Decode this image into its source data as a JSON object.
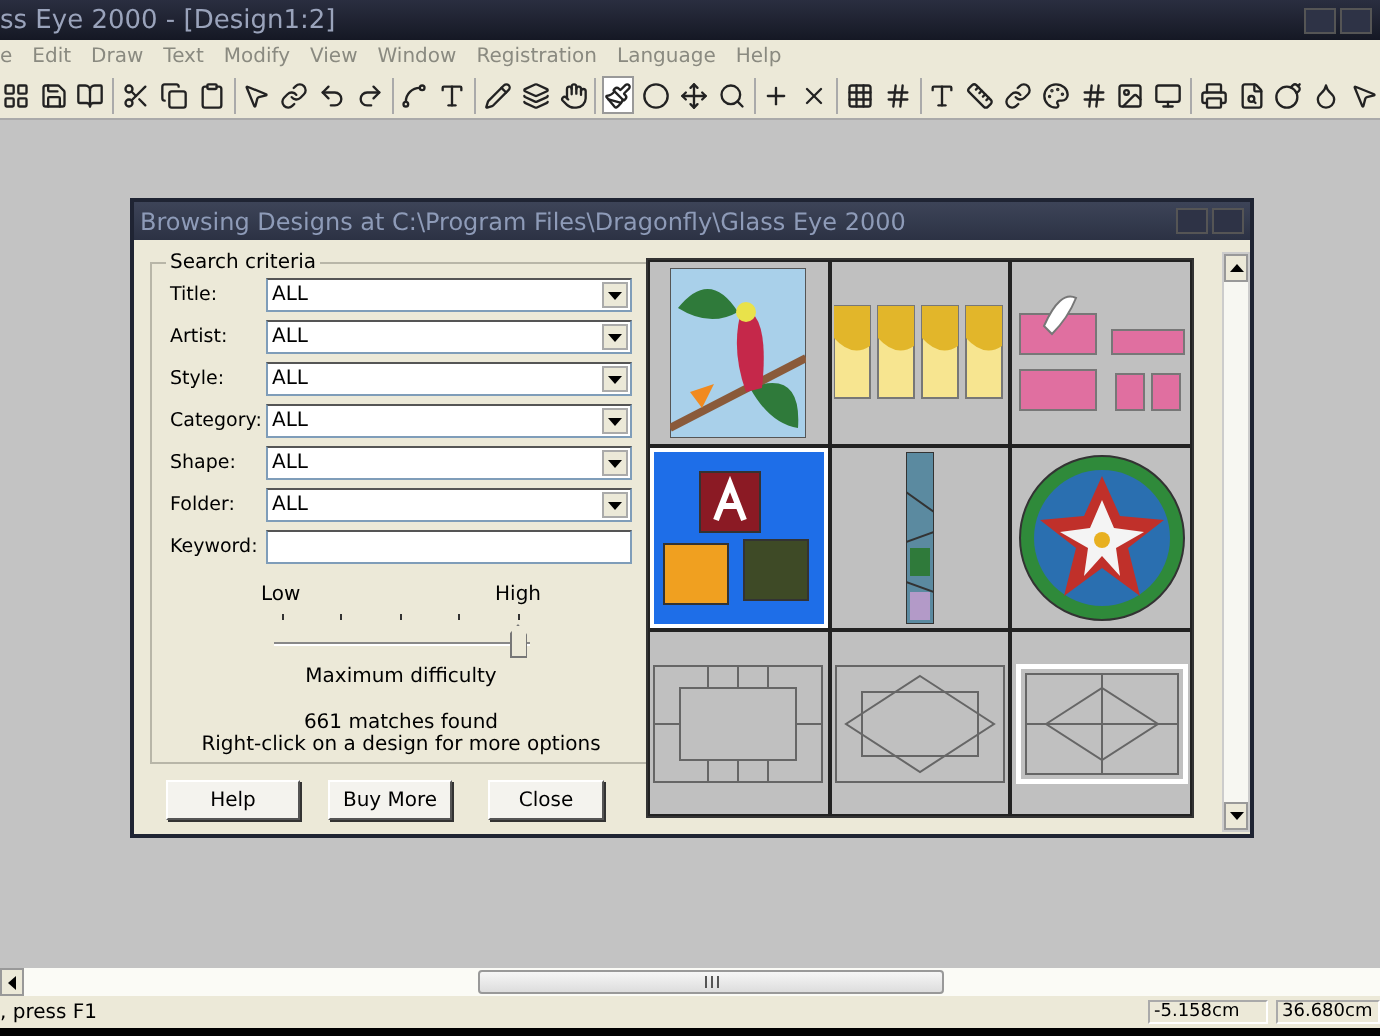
{
  "window": {
    "title": "ss Eye 2000 - [Design1:2]"
  },
  "menu": [
    "e",
    "Edit",
    "Draw",
    "Text",
    "Modify",
    "View",
    "Window",
    "Registration",
    "Language",
    "Help"
  ],
  "dialog": {
    "title": "Browsing Designs at C:\\Program Files\\Dragonfly\\Glass Eye 2000",
    "group_title": "Search criteria",
    "fields": [
      {
        "label": "Title:",
        "value": "ALL",
        "kind": "combo"
      },
      {
        "label": "Artist:",
        "value": "ALL",
        "kind": "combo"
      },
      {
        "label": "Style:",
        "value": "ALL",
        "kind": "combo"
      },
      {
        "label": "Category:",
        "value": "ALL",
        "kind": "combo"
      },
      {
        "label": "Shape:",
        "value": "ALL",
        "kind": "combo"
      },
      {
        "label": "Folder:",
        "value": "ALL",
        "kind": "combo"
      },
      {
        "label": "Keyword:",
        "kind": "text"
      }
    ],
    "difficulty": {
      "low": "Low",
      "high": "High",
      "level": 1,
      "caption": "Maximum difficulty"
    },
    "matches": "661 matches found",
    "hint": "Right-click on a design for more options",
    "buttons": [
      "Help",
      "Buy More",
      "Close"
    ],
    "designs": [
      {
        "kind": "parrot",
        "selected": false
      },
      {
        "kind": "panels",
        "selected": false
      },
      {
        "kind": "doves",
        "selected": false
      },
      {
        "kind": "blocks",
        "selected": true
      },
      {
        "kind": "strip",
        "selected": false
      },
      {
        "kind": "flower",
        "selected": false
      },
      {
        "kind": "frame",
        "selected": false
      },
      {
        "kind": "diamond",
        "selected": false
      },
      {
        "kind": "bevel",
        "selected": false
      }
    ]
  },
  "status_bar": {
    "message": ", press F1",
    "x": "-5.158cm",
    "y": "36.680cm"
  }
}
